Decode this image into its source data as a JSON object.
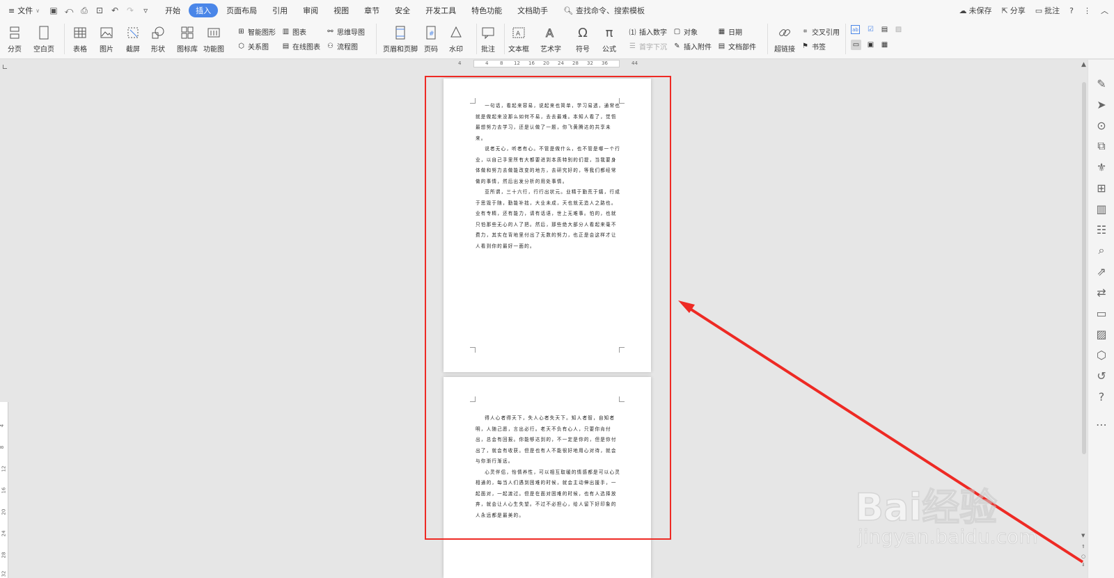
{
  "menubar": {
    "file_label": "文件",
    "tabs": [
      "开始",
      "插入",
      "页面布局",
      "引用",
      "审阅",
      "视图",
      "章节",
      "安全",
      "开发工具",
      "特色功能",
      "文档助手"
    ],
    "active_tab": "插入",
    "search_label": "查找命令、搜索模板",
    "unsaved": "未保存",
    "share": "分享",
    "comment": "批注",
    "help": "?"
  },
  "ribbon": {
    "page_break": "分页",
    "blank_page": "空白页",
    "table": "表格",
    "picture": "图片",
    "screenshot": "截屏",
    "shapes": "形状",
    "icon_library": "图标库",
    "function_chart": "功能图",
    "smart_art": "智能图形",
    "chart": "图表",
    "mind_map": "思维导图",
    "relation_chart": "关系图",
    "online_chart": "在线图表",
    "flowchart": "流程图",
    "header_footer": "页眉和页脚",
    "page_number": "页码",
    "watermark": "水印",
    "comment": "批注",
    "text_box": "文本框",
    "word_art": "艺术字",
    "symbol": "符号",
    "formula": "公式",
    "insert_number": "插入数字",
    "object": "对象",
    "date": "日期",
    "drop_cap": "首字下沉",
    "attachment": "插入附件",
    "doc_parts": "文档部件",
    "hyperlink": "超链接",
    "cross_ref": "交叉引用",
    "bookmark": "书签"
  },
  "ruler": {
    "h_ticks": [
      "4",
      "4",
      "8",
      "12",
      "16",
      "20",
      "24",
      "28",
      "32",
      "36",
      "44"
    ],
    "v_ticks": [
      "4",
      "8",
      "12",
      "16",
      "20",
      "24",
      "28",
      "32"
    ]
  },
  "document": {
    "page1_paragraphs": [
      "一句话，看起来容易，说起来也简单，学习易透，通常也就是做起来没那么如何不易，去去最难。本知人看了，觉悟最想努力去学习，还是认做了一题，你飞黄腾达的共享未来。",
      "说者无心，听者有心。不管是做什么，也不管是哪一个行业，以自己手里所有大都要进到本质特别的们提，当我要身体做和努力去做能改变的地方，去研究好的，等我们都经常做的事情，然后出发分析的用处事情。",
      "亚所谓，三十六行，行行出状元。业精于勤荒于嬉，行成于思毁于随，勤能补拙，大业未成，天也就无造人之路也。业有专精，还有能力，请有话语，世上无难事。怕的，也就只怕那些无心的人了把。然后，那些绝大部分人看起来毫不费力，其实在背地里付出了无数的努力，也正是会这样才让人看到你的最好一面的。"
    ],
    "page2_paragraphs": [
      "得人心者得天下，失人心者失天下。知人者智，自知者明，人随己愿，言出必行。老天不负有心人，只要你肯付出，总会有回报。你能够达到的，不一定是你的，但是你付出了，就会有收获。但是也有人不能很好地用心对待，就会与你渐行渐远。",
      "心灵伴侣，怡情养性，可以相互取暖的情感都是可以心灵相通的，每当人们遇到困难的时候，就会主动伸出援手，一起面对，一起渡过。但是在面对困难的时候，也有人选择放弃，就会让人心生失望。不过不必担心，给人留下好印象的人永远都是最美的。"
    ]
  },
  "watermark": {
    "brand": "Bai经验",
    "url": "jingyan.baidu.com"
  },
  "colors": {
    "accent": "#4a86e8",
    "annotation_red": "#ee2a24"
  }
}
